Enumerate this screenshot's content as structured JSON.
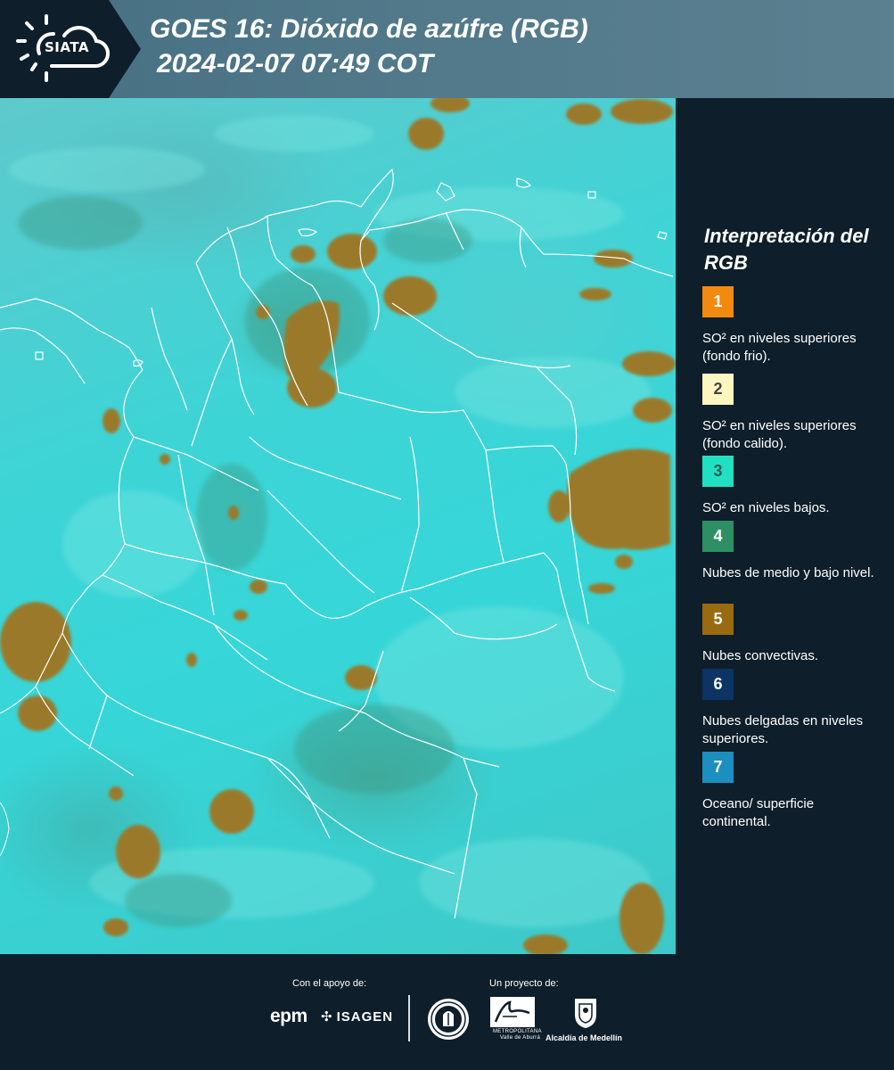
{
  "header": {
    "logo_text": "SIATA",
    "title_line1": "GOES 16: Dióxido de azúfre (RGB)",
    "title_line2": "2024-02-07 07:49 COT"
  },
  "colors": {
    "header_bg": "#4f7888",
    "page_bg": "#0e1e2b",
    "map_base": "#36d6d8",
    "cloud_brown": "#9a7a2c"
  },
  "legend": {
    "title": "Interpretación del RGB",
    "items": [
      {
        "number": "1",
        "label": "SO² en niveles superiores (fondo frio).",
        "color": "#f28a10",
        "number_color": "#ffffff"
      },
      {
        "number": "2",
        "label": "SO² en niveles superiores (fondo calido).",
        "color": "#fdf6c0",
        "number_color": "#444444"
      },
      {
        "number": "3",
        "label": "SO² en niveles bajos.",
        "color": "#21e0c2",
        "number_color": "#2f5a52"
      },
      {
        "number": "4",
        "label": "Nubes de medio y bajo nivel.",
        "color": "#2e8f64",
        "number_color": "#ffffff"
      },
      {
        "number": "5",
        "label": "Nubes convectivas.",
        "color": "#9a6a10",
        "number_color": "#ffffff"
      },
      {
        "number": "6",
        "label": "Nubes delgadas en niveles superiores.",
        "color": "#0c3464",
        "number_color": "#ffffff"
      },
      {
        "number": "7",
        "label": "Oceano/ superficie continental.",
        "color": "#1b8fbf",
        "number_color": "#ffffff"
      }
    ]
  },
  "footer": {
    "support_label": "Con el apoyo de:",
    "project_label": "Un proyecto de:",
    "sponsor_1": "epm",
    "sponsor_2": "ISAGEN",
    "area_text_1": "METROPOLITANA",
    "area_text_2": "Valle de Aburrá",
    "alcaldia": "Alcaldía de Medellín"
  }
}
